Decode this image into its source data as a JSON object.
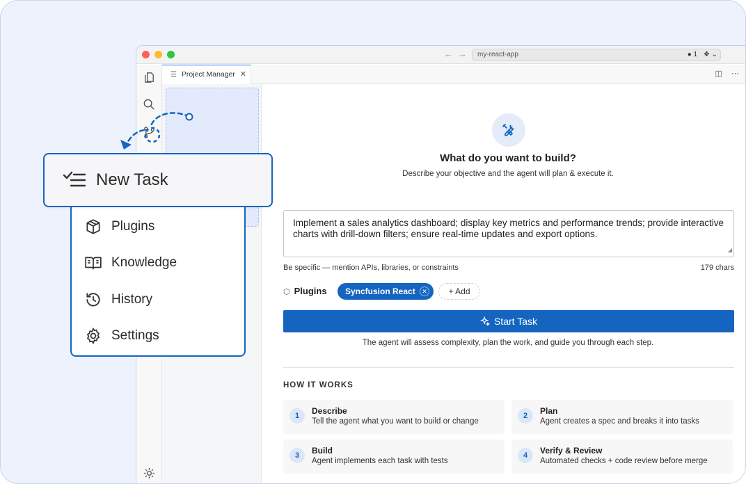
{
  "window": {
    "nav_back": "←",
    "nav_forward": "→",
    "command_center": "my-react-app",
    "status_count": "● 1",
    "status_icon": "❖ ⌄"
  },
  "tab": {
    "label": "Project Manager",
    "close": "✕"
  },
  "hero": {
    "title": "What do you want to build?",
    "subtitle": "Describe your objective and the agent will plan & execute it."
  },
  "prompt": {
    "value": "Implement a sales analytics dashboard; display key metrics and performance trends; provide interactive charts with drill-down filters; ensure real-time updates and export options.",
    "hint": "Be specific — mention APIs, libraries, or constraints",
    "char_count": "179 chars"
  },
  "plugins": {
    "label": "Plugins",
    "selected": "Syncfusion React",
    "remove": "✕",
    "add_label": "+ Add"
  },
  "start": {
    "label": "Start Task",
    "note": "The agent will assess complexity, plan the work, and guide you through each step."
  },
  "how_it_works": {
    "title": "HOW IT WORKS",
    "steps": [
      {
        "num": "1",
        "title": "Describe",
        "desc": "Tell the agent what you want to build or change"
      },
      {
        "num": "2",
        "title": "Plan",
        "desc": "Agent creates a spec and breaks it into tasks"
      },
      {
        "num": "3",
        "title": "Build",
        "desc": "Agent implements each task with tests"
      },
      {
        "num": "4",
        "title": "Verify & Review",
        "desc": "Automated checks + code review before merge"
      }
    ]
  },
  "callout": {
    "new_task": "New Task",
    "items": [
      {
        "label": "Plugins",
        "icon": "box-icon"
      },
      {
        "label": "Knowledge",
        "icon": "book-icon"
      },
      {
        "label": "History",
        "icon": "history-icon"
      },
      {
        "label": "Settings",
        "icon": "gear-icon"
      }
    ]
  },
  "colors": {
    "accent": "#1565c0",
    "background": "#eef2fd"
  }
}
